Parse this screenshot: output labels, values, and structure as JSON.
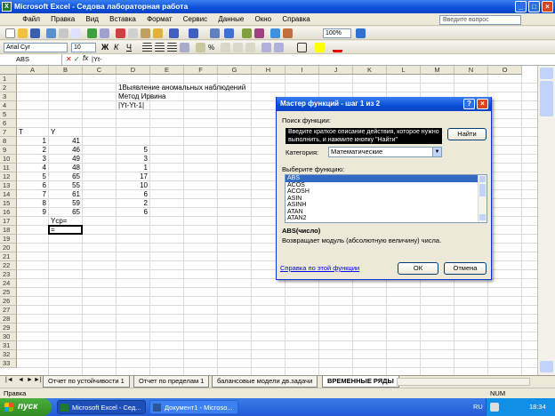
{
  "window": {
    "title": "Microsoft Excel - Седова лабораторная работа"
  },
  "menu": {
    "items": [
      "Файл",
      "Правка",
      "Вид",
      "Вставка",
      "Формат",
      "Сервис",
      "Данные",
      "Окно",
      "Справка"
    ],
    "ask_placeholder": "Введите вопрос"
  },
  "toolbar": {
    "zoom": "100%",
    "font": "Arial Cyr",
    "size": "10"
  },
  "formula_bar": {
    "name_box": "ABS",
    "formula": "|Yt-"
  },
  "columns": [
    "A",
    "B",
    "C",
    "D",
    "E",
    "F",
    "G",
    "H",
    "I",
    "J",
    "K",
    "L",
    "M",
    "N",
    "O"
  ],
  "rows": [
    "1",
    "2",
    "3",
    "4",
    "5",
    "6",
    "7",
    "8",
    "9",
    "10",
    "11",
    "12",
    "13",
    "14",
    "15",
    "16",
    "17",
    "18",
    "19",
    "20",
    "21",
    "22",
    "23",
    "24",
    "25",
    "26",
    "27",
    "28",
    "29",
    "30",
    "31",
    "32",
    "33"
  ],
  "cells": {
    "D2": "1Выявление аномальных наблюдений",
    "D3": "Метод Ирвина",
    "D4": "|Yt-Yt-1|",
    "A7": "T",
    "B7": "Y",
    "A8": "1",
    "B8": "41",
    "A9": "2",
    "B9": "46",
    "D9": "5",
    "A10": "3",
    "B10": "49",
    "D10": "3",
    "A11": "4",
    "B11": "48",
    "D11": "1",
    "A12": "5",
    "B12": "65",
    "D12": "17",
    "A13": "6",
    "B13": "55",
    "D13": "10",
    "A14": "7",
    "B14": "61",
    "D14": "6",
    "A15": "8",
    "B15": "59",
    "D15": "2",
    "A16": "9",
    "B16": "65",
    "D16": "6",
    "B17": "Ycp=",
    "B18": "="
  },
  "sheet_tabs": [
    "Отчет по устойчивости 1",
    "Отчет по пределам 1",
    "балансовые модели дв.задачи",
    "ВРЕМЕННЫЕ РЯДЫ"
  ],
  "status": {
    "left": "Правка",
    "num": "NUM"
  },
  "taskbar": {
    "start": "пуск",
    "items": [
      "Microsoft Excel - Сед...",
      "Документ1 - Microso..."
    ],
    "lang": "RU",
    "time": "18:34"
  },
  "dialog": {
    "title": "Мастер функций - шаг 1 из 2",
    "search_label": "Поиск функции:",
    "search_text": "Введите краткое описание действия, которое нужно выполнить, и нажмите кнопку \"Найти\"",
    "find_button": "Найти",
    "category_label": "Категория:",
    "category_value": "Математические",
    "select_label": "Выберите функцию:",
    "functions": [
      "ABS",
      "ACOS",
      "ACOSH",
      "ASIN",
      "ASINH",
      "ATAN",
      "ATAN2"
    ],
    "signature": "ABS(число)",
    "description": "Возвращает модуль (абсолютную величину) числа.",
    "help_link": "Справка по этой функции",
    "ok": "ОК",
    "cancel": "Отмена"
  }
}
